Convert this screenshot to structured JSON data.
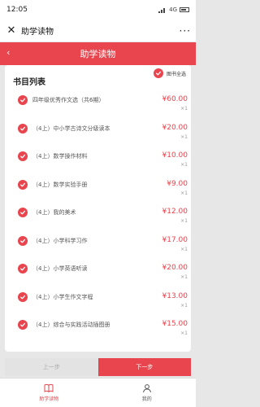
{
  "status": {
    "time": "12:05",
    "signal": "4G"
  },
  "wechat": {
    "close_glyph": "✕",
    "title": "助学读物",
    "more_glyph": "···"
  },
  "header": {
    "back_glyph": "‹",
    "title": "助学读物"
  },
  "select_all_label": "图书全选",
  "list_title": "书目列表",
  "books": [
    {
      "name": "四年级优秀作文选（共6期）",
      "price": "¥60.00",
      "qty": "×1"
    },
    {
      "name": "（4上）中小学古诗文分级读本",
      "price": "¥20.00",
      "qty": "×1"
    },
    {
      "name": "（4上）数学操作材料",
      "price": "¥10.00",
      "qty": "×1"
    },
    {
      "name": "（4上）数学实验手册",
      "price": "¥9.00",
      "qty": "×1"
    },
    {
      "name": "（4上）我的美术",
      "price": "¥12.00",
      "qty": "×1"
    },
    {
      "name": "（4上）小学科学习作",
      "price": "¥17.00",
      "qty": "×1"
    },
    {
      "name": "（4上）小学英语听读",
      "price": "¥20.00",
      "qty": "×1"
    },
    {
      "name": "（4上）小学生作文字程",
      "price": "¥13.00",
      "qty": "×1"
    },
    {
      "name": "（4上）综合与实践活动插图册",
      "price": "¥15.00",
      "qty": "×1"
    }
  ],
  "buttons": {
    "prev": "上一步",
    "next": "下一步"
  },
  "tabs": [
    {
      "label": "助学读物",
      "icon": "book-icon",
      "active": true
    },
    {
      "label": "我的",
      "icon": "user-icon",
      "active": false
    }
  ],
  "colors": {
    "accent": "#e8454e"
  }
}
